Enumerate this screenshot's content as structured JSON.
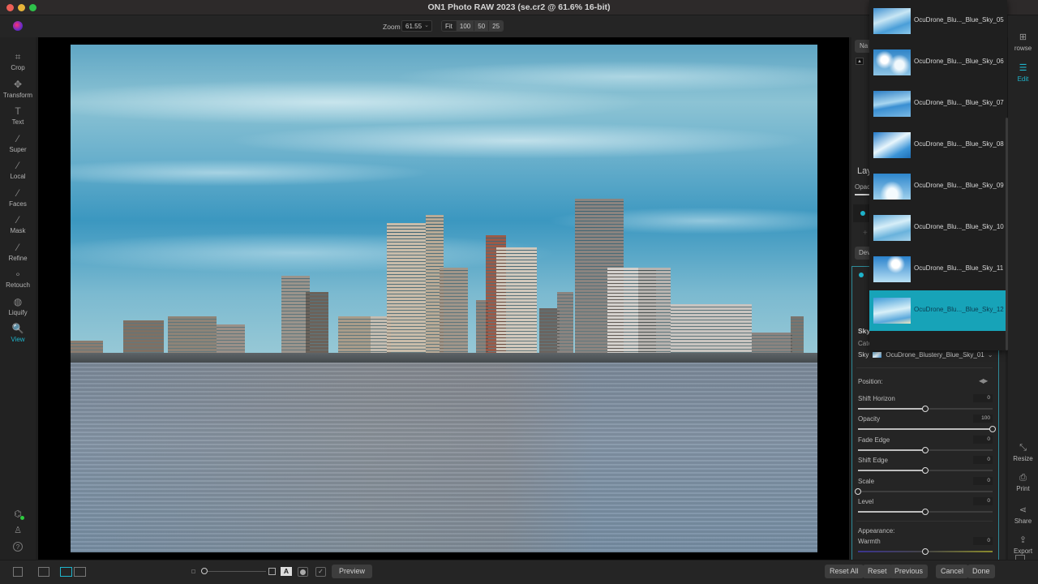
{
  "window": {
    "title": "ON1 Photo RAW 2023 (se.cr2 @ 61.6% 16-bit)"
  },
  "toolbar": {
    "zoom_label": "Zoom",
    "zoom_value": "61.55",
    "zoom_presets": [
      "Fit",
      "100",
      "50",
      "25"
    ],
    "active_preset": "Fit"
  },
  "left_tools": [
    {
      "label": "Crop",
      "icon": "crop-icon",
      "glyph": "⌗"
    },
    {
      "label": "Transform",
      "icon": "move-icon",
      "glyph": "✥"
    },
    {
      "label": "Text",
      "icon": "text-icon",
      "glyph": "T"
    },
    {
      "label": "Super",
      "icon": "magic-brush-icon",
      "glyph": "⁄"
    },
    {
      "label": "Local",
      "icon": "brush-icon",
      "glyph": "⁄"
    },
    {
      "label": "Faces",
      "icon": "face-brush-icon",
      "glyph": "⁄"
    },
    {
      "label": "Mask",
      "icon": "mask-brush-icon",
      "glyph": "⁄"
    },
    {
      "label": "Refine",
      "icon": "refine-brush-icon",
      "glyph": "⁄"
    },
    {
      "label": "Retouch",
      "icon": "retouch-icon",
      "glyph": "∘"
    },
    {
      "label": "Liquify",
      "icon": "fingerprint-icon",
      "glyph": "◍"
    },
    {
      "label": "View",
      "icon": "view-zoom-icon",
      "glyph": "🔍",
      "active": true
    }
  ],
  "right_panel": {
    "nav_tab": "Na",
    "layers_title": "Lay",
    "opacity_label": "Opac",
    "develop_tab": "Dev",
    "sky_section": "Sky",
    "category_label": "Cate",
    "sky_label": "Sky",
    "sky_value": "OcuDrone_Blustery_Blue_Sky_01",
    "position_label": "Position:",
    "appearance_label": "Appearance:",
    "sliders": [
      {
        "label": "Shift Horizon",
        "value": "0",
        "fraction": 0.5
      },
      {
        "label": "Opacity",
        "value": "100",
        "fraction": 1.0
      },
      {
        "label": "Fade Edge",
        "value": "0",
        "fraction": 0.5
      },
      {
        "label": "Shift Edge",
        "value": "0",
        "fraction": 0.5
      },
      {
        "label": "Scale",
        "value": "0",
        "fraction": 0.0
      },
      {
        "label": "Level",
        "value": "0",
        "fraction": 0.5
      }
    ],
    "warmth": {
      "label": "Warmth",
      "value": "0",
      "fraction": 0.5
    }
  },
  "sky_dropdown": {
    "items": [
      {
        "label": "OcuDrone_Blu..._Blue_Sky_05"
      },
      {
        "label": "OcuDrone_Blu..._Blue_Sky_06"
      },
      {
        "label": "OcuDrone_Blu..._Blue_Sky_07"
      },
      {
        "label": "OcuDrone_Blu..._Blue_Sky_08"
      },
      {
        "label": "OcuDrone_Blu..._Blue_Sky_09"
      },
      {
        "label": "OcuDrone_Blu..._Blue_Sky_10"
      },
      {
        "label": "OcuDrone_Blu..._Blue_Sky_11"
      },
      {
        "label": "OcuDrone_Blu..._Blue_Sky_12",
        "selected": true
      }
    ]
  },
  "far_right": {
    "top": [
      {
        "label": "rowse",
        "icon": "browse-icon",
        "glyph": "⊞"
      },
      {
        "label": "Edit",
        "icon": "sliders-icon",
        "glyph": "☰",
        "active": true
      }
    ],
    "bottom": [
      {
        "label": "Resize",
        "icon": "resize-icon",
        "glyph": "⤡"
      },
      {
        "label": "Print",
        "icon": "printer-icon",
        "glyph": "⎙"
      },
      {
        "label": "Share",
        "icon": "share-icon",
        "glyph": "⋖"
      },
      {
        "label": "Export",
        "icon": "export-icon",
        "glyph": "⇪"
      }
    ]
  },
  "bottombar": {
    "preview": "Preview",
    "reset_all": "Reset All",
    "reset": "Reset",
    "previous": "Previous",
    "cancel": "Cancel",
    "done": "Done",
    "a_glyph": "A",
    "check_glyph": "✓"
  },
  "colors": {
    "accent": "#1fb5cc",
    "selected_item": "#17a3b8"
  }
}
